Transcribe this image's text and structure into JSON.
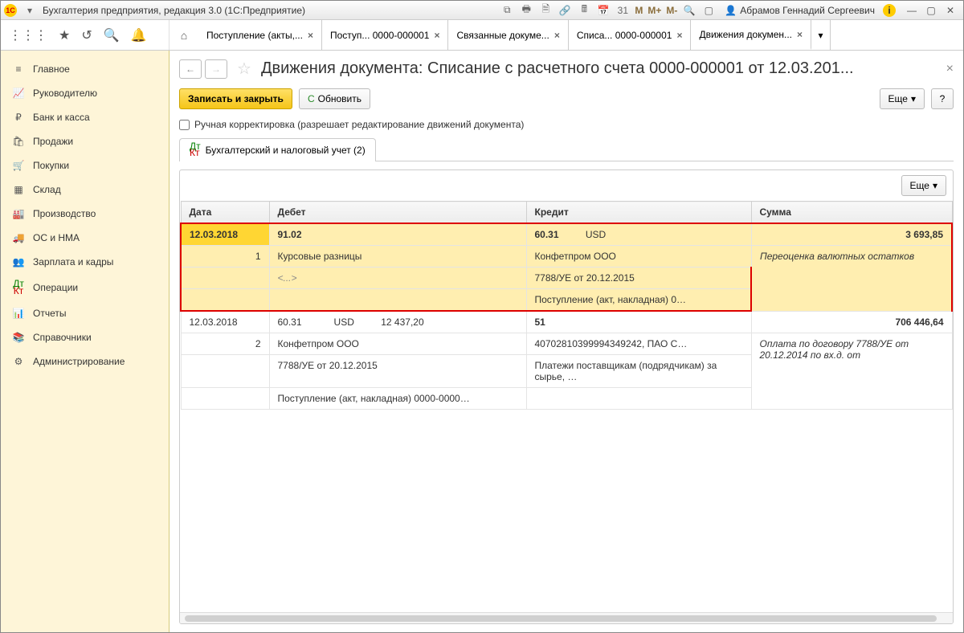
{
  "titlebar": {
    "logo": "1С",
    "dropdown": "▾",
    "app_title": "Бухгалтерия предприятия, редакция 3.0   (1С:Предприятие)",
    "m_labels": [
      "M",
      "M+",
      "M-"
    ],
    "user": "Абрамов Геннадий Сергеевич",
    "info_icon": "i"
  },
  "sidebar": {
    "items": [
      {
        "icon": "≡",
        "label": "Главное"
      },
      {
        "icon": "📈",
        "label": "Руководителю"
      },
      {
        "icon": "₽",
        "label": "Банк и касса"
      },
      {
        "icon": "🛍",
        "label": "Продажи"
      },
      {
        "icon": "🛒",
        "label": "Покупки"
      },
      {
        "icon": "▦",
        "label": "Склад"
      },
      {
        "icon": "🏭",
        "label": "Производство"
      },
      {
        "icon": "🚚",
        "label": "ОС и НМА"
      },
      {
        "icon": "👥",
        "label": "Зарплата и кадры"
      },
      {
        "icon": "Дт",
        "label": "Операции"
      },
      {
        "icon": "📊",
        "label": "Отчеты"
      },
      {
        "icon": "📚",
        "label": "Справочники"
      },
      {
        "icon": "⚙",
        "label": "Администрирование"
      }
    ]
  },
  "tabs": [
    {
      "label": "Поступление (акты,..."
    },
    {
      "label": "Поступ... 0000-000001"
    },
    {
      "label": "Связанные докуме..."
    },
    {
      "label": "Списа... 0000-000001"
    },
    {
      "label": "Движения докумен...",
      "active": true
    }
  ],
  "doc": {
    "title": "Движения документа: Списание с расчетного счета 0000-000001 от 12.03.201...",
    "save_close": "Записать и закрыть",
    "refresh": "Обновить",
    "more": "Еще",
    "help": "?",
    "manual_adjust": "Ручная корректировка (разрешает редактирование движений документа)",
    "page_tab": "Бухгалтерский и налоговый учет (2)"
  },
  "grid": {
    "more": "Еще",
    "headers": {
      "date": "Дата",
      "debit": "Дебет",
      "credit": "Кредит",
      "sum": "Сумма"
    },
    "r1": {
      "date": "12.03.2018",
      "seq": "1",
      "debit_acc": "91.02",
      "debit_l1": "Курсовые разницы",
      "debit_l2": "<...>",
      "credit_acc": "60.31",
      "credit_cur": "USD",
      "credit_l1": "Конфетпром ООО",
      "credit_l2": "7788/УЕ от 20.12.2015",
      "credit_l3": "Поступление (акт, накладная) 0…",
      "sum": "3 693,85",
      "comment": "Переоценка валютных остатков"
    },
    "r2": {
      "date": "12.03.2018",
      "seq": "2",
      "debit_acc": "60.31",
      "debit_cur": "USD",
      "debit_amt": "12 437,20",
      "debit_l1": "Конфетпром ООО",
      "debit_l2": "7788/УЕ от 20.12.2015",
      "debit_l3": "Поступление (акт, накладная) 0000-0000…",
      "credit_acc": "51",
      "credit_l1": "40702810399994349242, ПАО С…",
      "credit_l2": "Платежи поставщикам (подрядчикам) за сырье, …",
      "sum": "706 446,64",
      "comment": "Оплата по договору 7788/УЕ от 20.12.2014 по вх.д.  от"
    }
  }
}
